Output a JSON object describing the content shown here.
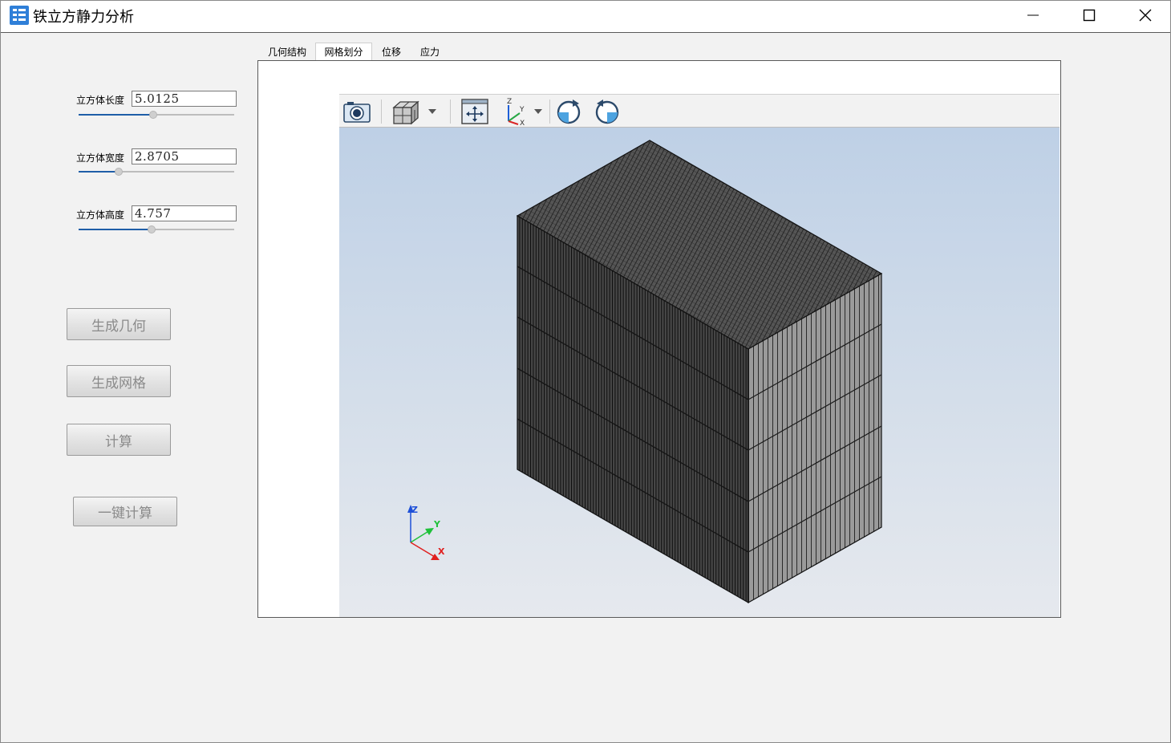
{
  "window": {
    "title": "铁立方静力分析",
    "icon": "app-logo-icon",
    "controls": [
      "minimize-icon",
      "maximize-icon",
      "close-icon"
    ]
  },
  "params": {
    "length": {
      "label": "立方体长度",
      "value": "5.0125",
      "slider_fraction": 0.48
    },
    "width": {
      "label": "立方体宽度",
      "value": "2.8705",
      "slider_fraction": 0.26
    },
    "height": {
      "label": "立方体高度",
      "value": "4.757",
      "slider_fraction": 0.47
    }
  },
  "buttons": {
    "gen_geometry": "生成几何",
    "gen_mesh": "生成网格",
    "compute": "计算",
    "one_click": "一键计算"
  },
  "tabs": {
    "items": [
      "几何结构",
      "网格划分",
      "位移",
      "应力"
    ],
    "active_index": 1
  },
  "viewer": {
    "toolbar": [
      "camera-icon",
      "display-mode-icon",
      "dropdown-arrow-icon",
      "fit-all-icon",
      "view-axes-icon",
      "dropdown-arrow-icon",
      "rotate-clockwise-icon",
      "rotate-counterclockwise-icon"
    ],
    "axes": {
      "x": "X",
      "y": "Y",
      "z": "Z"
    },
    "background_top": "#bed0e6",
    "background_bottom": "#e6e9ee",
    "mesh_top_color": "#3a3a3a",
    "mesh_front_color": "#262626",
    "mesh_side_color": "#9a9a9a"
  }
}
